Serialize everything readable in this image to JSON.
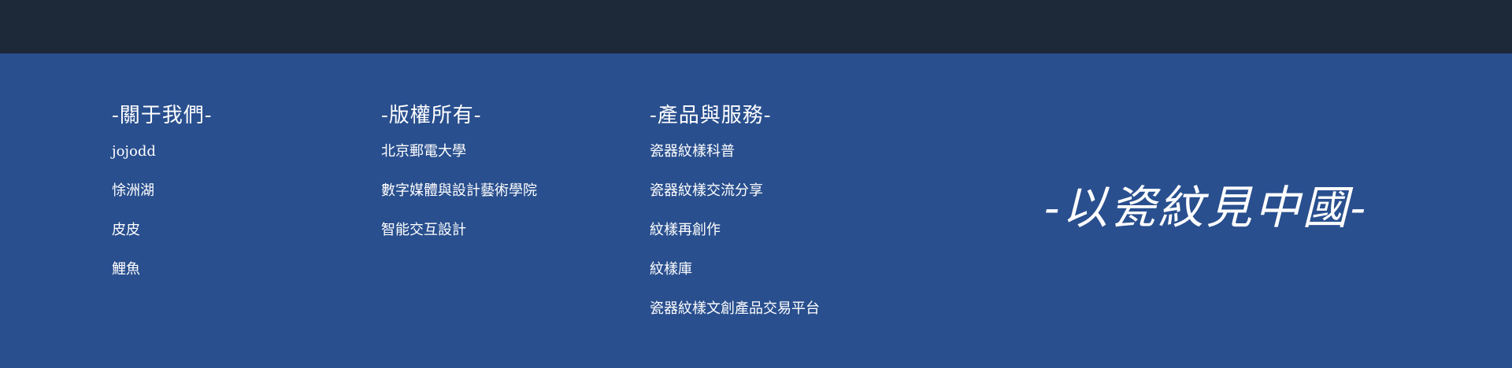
{
  "colors": {
    "top_bar": "#1d2839",
    "footer_bg": "#294f8e",
    "text": "#ffffff"
  },
  "footer": {
    "columns": [
      {
        "title": "-關于我們-",
        "items": [
          "jojodd",
          "悇洲湖",
          "皮皮",
          "鯉魚"
        ]
      },
      {
        "title": "-版權所有-",
        "items": [
          "北京郵電大學",
          "數字媒體與設計藝術學院",
          "智能交互設計"
        ]
      },
      {
        "title": "-產品與服務-",
        "items": [
          "瓷器紋樣科普",
          "瓷器紋樣交流分享",
          "紋樣再創作",
          "紋樣庫",
          "瓷器紋樣文創產品交易平台"
        ]
      }
    ],
    "slogan": "-以瓷紋見中國-"
  }
}
